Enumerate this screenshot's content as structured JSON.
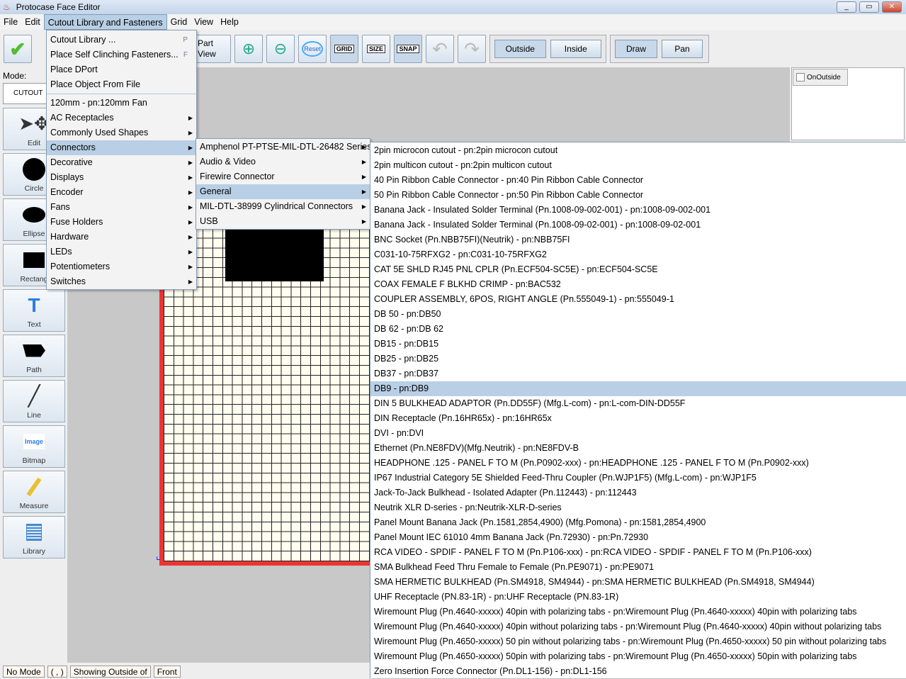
{
  "window": {
    "title": "Protocase Face Editor",
    "minimize": "_",
    "maximize": "▭",
    "close": "✕"
  },
  "menubar": [
    "File",
    "Edit",
    "Cutout Library and Fasteners",
    "Grid",
    "View",
    "Help"
  ],
  "toolbar": {
    "part_view": "Part View",
    "reset": "Reset",
    "grid": "GRID",
    "size": "SIZE",
    "snap": "SNAP",
    "outside": "Outside",
    "inside": "Inside",
    "draw": "Draw",
    "pan": "Pan"
  },
  "left": {
    "mode_label": "Mode:",
    "mode_value": "CUTOUT",
    "tools": [
      "Edit",
      "Circle",
      "Ellipse",
      "Rectang",
      "Text",
      "Path",
      "Line",
      "Bitmap",
      "Measure",
      "Library"
    ],
    "image_icon_text": "Image"
  },
  "right": {
    "onoutside": "OnOutside",
    "onoutside_checked": false
  },
  "status": [
    "No Mode",
    "( , )",
    "Showing Outside of",
    "Front"
  ],
  "menu1": {
    "top": [
      {
        "label": "Cutout Library ...",
        "acc": "P"
      },
      {
        "label": "Place Self Clinching Fasteners...",
        "acc": "F"
      },
      {
        "label": "Place DPort"
      },
      {
        "label": "Place Object From File"
      }
    ],
    "items": [
      {
        "label": "120mm - pn:120mm Fan",
        "sub": false
      },
      {
        "label": "AC Receptacles",
        "sub": true
      },
      {
        "label": "Commonly Used Shapes",
        "sub": true
      },
      {
        "label": "Connectors",
        "sub": true,
        "hl": true
      },
      {
        "label": "Decorative",
        "sub": true
      },
      {
        "label": "Displays",
        "sub": true
      },
      {
        "label": "Encoder",
        "sub": true
      },
      {
        "label": "Fans",
        "sub": true
      },
      {
        "label": "Fuse Holders",
        "sub": true
      },
      {
        "label": "Hardware",
        "sub": true
      },
      {
        "label": "LEDs",
        "sub": true
      },
      {
        "label": "Potentiometers",
        "sub": true
      },
      {
        "label": "Switches",
        "sub": true
      }
    ]
  },
  "menu2": [
    {
      "label": "Amphenol PT-PTSE-MIL-DTL-26482 Series",
      "sub": true
    },
    {
      "label": "Audio & Video",
      "sub": true
    },
    {
      "label": "Firewire Connector",
      "sub": true
    },
    {
      "label": "General",
      "sub": true,
      "hl": true
    },
    {
      "label": "MIL-DTL-38999 Cylindrical Connectors",
      "sub": true
    },
    {
      "label": "USB",
      "sub": true
    }
  ],
  "menu3": {
    "selected": "DB9 - pn:DB9",
    "items": [
      "2pin microcon cutout - pn:2pin microcon cutout",
      "2pin multicon cutout - pn:2pin multicon cutout",
      "40 Pin Ribbon Cable Connector - pn:40 Pin Ribbon Cable Connector",
      "50 Pin Ribbon Cable Connector - pn:50 Pin Ribbon Cable Connector",
      "Banana Jack - Insulated Solder Terminal (Pn.1008-09-002-001) - pn:1008-09-002-001",
      "Banana Jack - Insulated Solder Terminal (Pn.1008-09-02-001) - pn:1008-09-02-001",
      "BNC Socket (Pn.NBB75FI)(Neutrik) - pn:NBB75FI",
      "C031-10-75RFXG2 - pn:C031-10-75RFXG2",
      "CAT 5E SHLD RJ45 PNL CPLR (Pn.ECF504-SC5E) - pn:ECF504-SC5E",
      "COAX FEMALE F BLKHD CRIMP - pn:BAC532",
      "COUPLER ASSEMBLY, 6POS, RIGHT ANGLE (Pn.555049-1) - pn:555049-1",
      "DB 50 - pn:DB50",
      "DB 62 - pn:DB 62",
      "DB15 - pn:DB15",
      "DB25 - pn:DB25",
      "DB37 - pn:DB37",
      "DB9 - pn:DB9",
      "DIN 5 BULKHEAD ADAPTOR (Pn.DD55F) (Mfg.L-com) - pn:L-com-DIN-DD55F",
      "DIN Receptacle (Pn.16HR65x) - pn:16HR65x",
      "DVI - pn:DVI",
      "Ethernet (Pn.NE8FDV)(Mfg.Neutrik) - pn:NE8FDV-B",
      "HEADPHONE .125 - PANEL F TO M (Pn.P0902-xxx) - pn:HEADPHONE .125 - PANEL F TO M (Pn.P0902-xxx)",
      "IP67 Industrial Category 5E Shielded Feed-Thru Coupler (Pn.WJP1F5) (Mfg.L-com) - pn:WJP1F5",
      "Jack-To-Jack Bulkhead - Isolated Adapter (Pn.112443) - pn:112443",
      "Neutrik XLR D-series - pn:Neutrik-XLR-D-series",
      "Panel Mount Banana Jack (Pn.1581,2854,4900) (Mfg.Pomona) - pn:1581,2854,4900",
      "Panel Mount IEC 61010 4mm Banana Jack (Pn.72930)  - pn:Pn.72930",
      "RCA VIDEO - SPDIF - PANEL F TO M (Pn.P106-xxx) - pn:RCA VIDEO - SPDIF - PANEL F TO M (Pn.P106-xxx)",
      "SMA Bulkhead Feed Thru Female to Female (Pn.PE9071) - pn:PE9071",
      "SMA HERMETIC BULKHEAD (Pn.SM4918, SM4944) - pn:SMA HERMETIC BULKHEAD (Pn.SM4918, SM4944)",
      "UHF Receptacle (PN.83-1R) - pn:UHF Receptacle (PN.83-1R)",
      "Wiremount Plug (Pn.4640-xxxxx) 40pin with polarizing tabs - pn:Wiremount Plug (Pn.4640-xxxxx) 40pin with polarizing tabs",
      "Wiremount Plug (Pn.4640-xxxxx) 40pin without polarizing tabs - pn:Wiremount Plug (Pn.4640-xxxxx) 40pin without polarizing tabs",
      "Wiremount Plug (Pn.4650-xxxxx) 50 pin without polarizing tabs - pn:Wiremount Plug (Pn.4650-xxxxx) 50 pin without polarizing tabs",
      "Wiremount Plug (Pn.4650-xxxxx) 50pin with polarizing tabs - pn:Wiremount Plug (Pn.4650-xxxxx) 50pin with polarizing tabs",
      "Zero Insertion Force Connector (Pn.DL1-156) - pn:DL1-156"
    ]
  },
  "colors": {
    "highlight": "#b8cfe5",
    "grid_border": "#ee3333",
    "canvas": "#c8c8c8"
  }
}
